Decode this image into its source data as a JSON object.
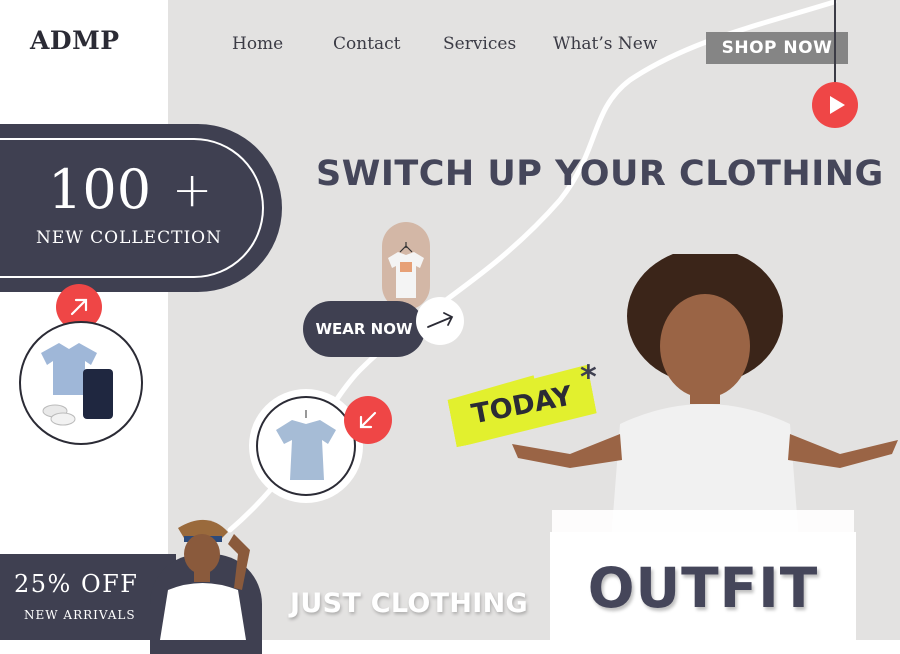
{
  "brand": {
    "logo": "ADMP"
  },
  "nav": {
    "items": [
      {
        "label": "Home"
      },
      {
        "label": "Contact"
      },
      {
        "label": "Services"
      },
      {
        "label": "What’s New"
      }
    ],
    "cta_label": "SHOP NOW"
  },
  "icons": {
    "play": "play-icon",
    "arrow_up_right": "arrow-up-right-icon",
    "arrow_down_left": "arrow-down-left-icon",
    "arrow_right": "arrow-right-icon"
  },
  "collection": {
    "count": "100",
    "plus": "+",
    "label": "NEW COLLECTION"
  },
  "hero": {
    "headline": "SWITCH UP YOUR CLOTHING",
    "wear_label": "WEAR NOW",
    "today_label": "TODAY",
    "today_mark": "*",
    "outfit_label": "OUTFIT",
    "tagline": "JUST CLOTHING"
  },
  "promo": {
    "discount": "25% OFF",
    "subtitle": "NEW ARRIVALS"
  },
  "colors": {
    "accent_red": "#ef4646",
    "navy": "#3f4051",
    "highlight_yellow": "#e2f02e",
    "background_gray": "#e3e2e1",
    "button_gray": "#858585"
  }
}
